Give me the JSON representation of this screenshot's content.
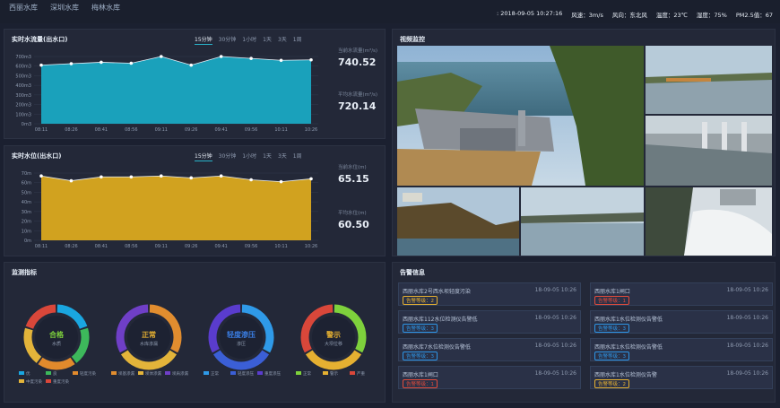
{
  "topbar": {
    "tabs": [
      "西丽水库",
      "深圳水库",
      "梅林水库"
    ],
    "datetime": ": 2018-09-05 10:27:16",
    "wind_speed": "风速：3m/s",
    "wind_dir": "风向：东北风",
    "temp": "温度：23℃",
    "humidity": "湿度：75%",
    "pm25": "PM2.5值：67"
  },
  "flow": {
    "title": "实时水流量(出水口)",
    "tabs": [
      "15分钟",
      "30分钟",
      "1小时",
      "1天",
      "3天",
      "1周"
    ],
    "active_tab": 0,
    "current_label": "当前水流量(m³/s)",
    "current_value": "740.52",
    "avg_label": "平均水流量(m³/s)",
    "avg_value": "720.14",
    "chart_data": {
      "type": "area",
      "x": [
        "08:11",
        "08:26",
        "08:41",
        "08:56",
        "09:11",
        "09:26",
        "09:41",
        "09:56",
        "10:11",
        "10:26"
      ],
      "values": [
        610,
        625,
        640,
        630,
        700,
        610,
        700,
        680,
        660,
        665
      ],
      "y_ticks": [
        "0m3",
        "100m3",
        "200m3",
        "300m3",
        "400m3",
        "500m3",
        "600m3",
        "700m3"
      ],
      "ylim": [
        0,
        700
      ],
      "color": "#1aa1bb"
    }
  },
  "level": {
    "title": "实时水位(出水口)",
    "tabs": [
      "15分钟",
      "30分钟",
      "1小时",
      "1天",
      "3天",
      "1周"
    ],
    "active_tab": 0,
    "current_label": "当前水位(m)",
    "current_value": "65.15",
    "avg_label": "平均水位(m)",
    "avg_value": "60.50",
    "chart_data": {
      "type": "area",
      "x": [
        "08:11",
        "08:26",
        "08:41",
        "08:56",
        "09:11",
        "09:26",
        "09:41",
        "09:56",
        "10:11",
        "10:26"
      ],
      "values": [
        67,
        62,
        66,
        66,
        67,
        65,
        67,
        63,
        61,
        64
      ],
      "y_ticks": [
        "0m",
        "10m",
        "20m",
        "30m",
        "40m",
        "50m",
        "60m",
        "70m"
      ],
      "ylim": [
        0,
        70
      ],
      "color": "#d1a21f"
    }
  },
  "video": {
    "title": "视频监控"
  },
  "indicators": {
    "title": "监测指标",
    "gauges": [
      {
        "status": "合格",
        "sub": "水质",
        "color": "#7ed13c",
        "colors": [
          "#1aa6e0",
          "#3db85b",
          "#e28a2c",
          "#e3b43a",
          "#d9473a"
        ],
        "legend": [
          "优",
          "良",
          "轻度污染",
          "中度污染",
          "重度污染"
        ]
      },
      {
        "status": "正常",
        "sub": "水库渗漏",
        "color": "#e5b031",
        "colors": [
          "#e18d2f",
          "#e3b43a",
          "#6f3fc7"
        ],
        "legend": [
          "坝基渗漏",
          "坝体渗漏",
          "坝肩渗漏"
        ]
      },
      {
        "status": "轻度渗压",
        "sub": "渗压",
        "color": "#3a7de2",
        "colors": [
          "#2f9ae8",
          "#3b5fd6",
          "#5a3ccd"
        ],
        "legend": [
          "正常",
          "轻度渗压",
          "重度渗压"
        ]
      },
      {
        "status": "警示",
        "sub": "大坝位移",
        "color": "#e5b031",
        "colors": [
          "#7ed13c",
          "#e5b031",
          "#d9473a"
        ],
        "legend": [
          "正常",
          "警示",
          "严重"
        ]
      }
    ]
  },
  "alerts": {
    "title": "告警信息",
    "items": [
      {
        "text": "西丽水库2号西水坝轻度污染",
        "date": "18-09-05 10:26",
        "badge": "告警等级：2",
        "color": "#e5b031"
      },
      {
        "text": "西丽水库1闸口",
        "date": "18-09-05 10:26",
        "badge": "告警等级：1",
        "color": "#e24b3b"
      },
      {
        "text": "西丽水库112水位检测仪告警低",
        "date": "18-09-05 10:26",
        "badge": "告警等级：3",
        "color": "#2d95e6"
      },
      {
        "text": "西丽水库1水位检测仪告警低",
        "date": "18-09-05 10:26",
        "badge": "告警等级：3",
        "color": "#2d95e6"
      },
      {
        "text": "西丽水库7水位检测仪告警低",
        "date": "18-09-05 10:26",
        "badge": "告警等级：3",
        "color": "#2d95e6"
      },
      {
        "text": "西丽水库1水位检测仪告警低",
        "date": "18-09-05 10:26",
        "badge": "告警等级：3",
        "color": "#2d95e6"
      },
      {
        "text": "西丽水库1闸口",
        "date": "18-09-05 10:26",
        "badge": "告警等级：1",
        "color": "#e24b3b"
      },
      {
        "text": "西丽水库1水位检测仪告警",
        "date": "18-09-05 10:26",
        "badge": "告警等级：2",
        "color": "#e5b031"
      }
    ]
  }
}
